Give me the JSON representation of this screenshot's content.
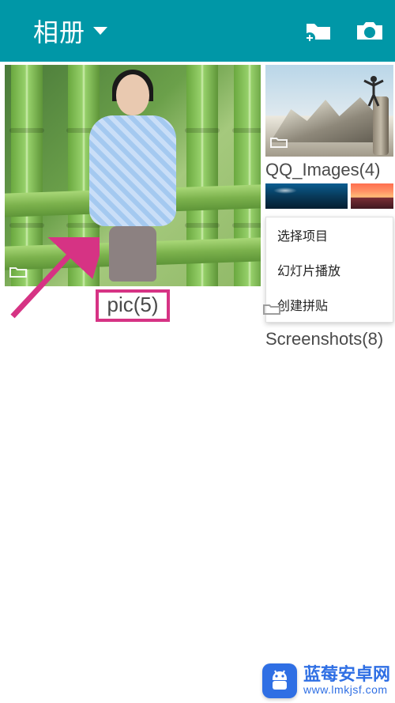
{
  "header": {
    "title": "相册"
  },
  "albums": {
    "main": {
      "label": "pic(5)"
    },
    "qq": {
      "label": "QQ_Images(4)"
    },
    "screenshots": {
      "label": "Screenshots(8)"
    }
  },
  "menu": {
    "select": "选择项目",
    "slideshow": "幻灯片播放",
    "collage": "创建拼贴"
  },
  "watermark": {
    "line1": "蓝莓安卓网",
    "line2": "www.lmkjsf.com"
  }
}
